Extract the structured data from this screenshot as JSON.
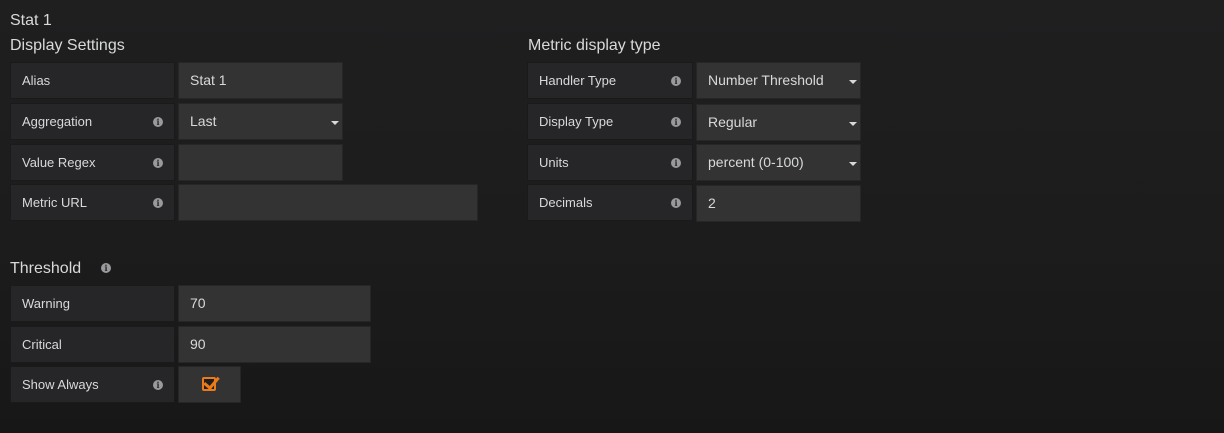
{
  "panel_title": "Stat 1",
  "display_settings": {
    "title": "Display Settings",
    "alias_label": "Alias",
    "alias_value": "Stat 1",
    "aggregation_label": "Aggregation",
    "aggregation_value": "Last",
    "value_regex_label": "Value Regex",
    "value_regex_value": "",
    "metric_url_label": "Metric URL",
    "metric_url_value": ""
  },
  "metric_display": {
    "title": "Metric display type",
    "handler_type_label": "Handler Type",
    "handler_type_value": "Number Threshold",
    "display_type_label": "Display Type",
    "display_type_value": "Regular",
    "units_label": "Units",
    "units_value": "percent (0-100)",
    "decimals_label": "Decimals",
    "decimals_value": "2"
  },
  "threshold": {
    "title": "Threshold",
    "warning_label": "Warning",
    "warning_value": "70",
    "critical_label": "Critical",
    "critical_value": "90",
    "show_always_label": "Show Always",
    "show_always_checked": true
  },
  "colors": {
    "background": "#1c1c1c",
    "label_bg": "#262628",
    "input_bg": "#333334",
    "text": "#d8d9da",
    "accent": "#eb7b18"
  },
  "icons": {
    "info": "info-icon",
    "dropdown": "caret-down-icon",
    "check": "checkmark-icon"
  }
}
